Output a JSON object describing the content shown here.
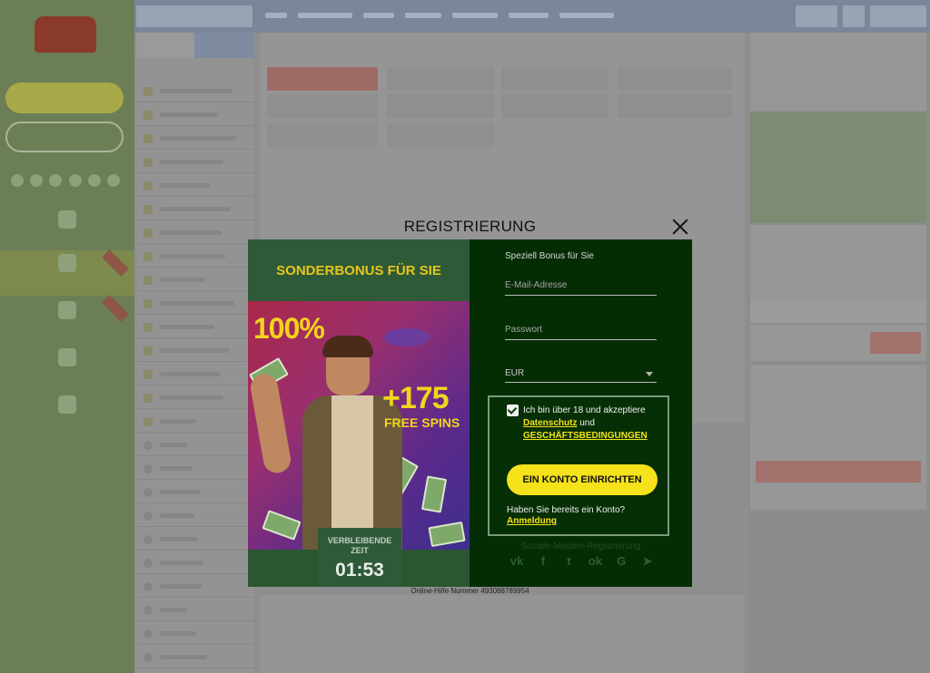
{
  "modal": {
    "title": "REGISTRIERUNG",
    "promo": {
      "heading": "SONDERBONUS FÜR SIE",
      "bonus_percent": "100%",
      "spins_count": "+175",
      "spins_label": "FREE SPINS",
      "timer_label": "VERBLEIBENDE ZEIT",
      "timer_value": "01:53"
    },
    "form": {
      "subtitle": "Speziell Bonus für Sie",
      "email_placeholder": "E-Mail-Adresse",
      "password_placeholder": "Passwort",
      "currency_value": "EUR",
      "consent_text": "Ich bin über 18 und akzeptiere",
      "privacy_link": "Datenschutz",
      "consent_and": "und",
      "terms_link": "GESCHÄFTSBEDINGUNGEN",
      "consent_checked": true,
      "create_button": "EIN KONTO EINRICHTEN",
      "have_account_text": "Haben Sie bereits ein Konto?",
      "login_link": "Anmeldung",
      "social_title": "Soziale-Medien-Registrierung",
      "social_icons": [
        "vk-icon",
        "facebook-icon",
        "twitter-icon",
        "odnoklassniki-icon",
        "google-icon",
        "telegram-icon"
      ]
    },
    "help_text": "Online-Hilfe Nummer 493088789954"
  },
  "colors": {
    "accent_yellow": "#f5e21b",
    "promo_green": "#2a5632",
    "form_bg": "#052d04",
    "overlay_grey": "#8c8c8c"
  }
}
